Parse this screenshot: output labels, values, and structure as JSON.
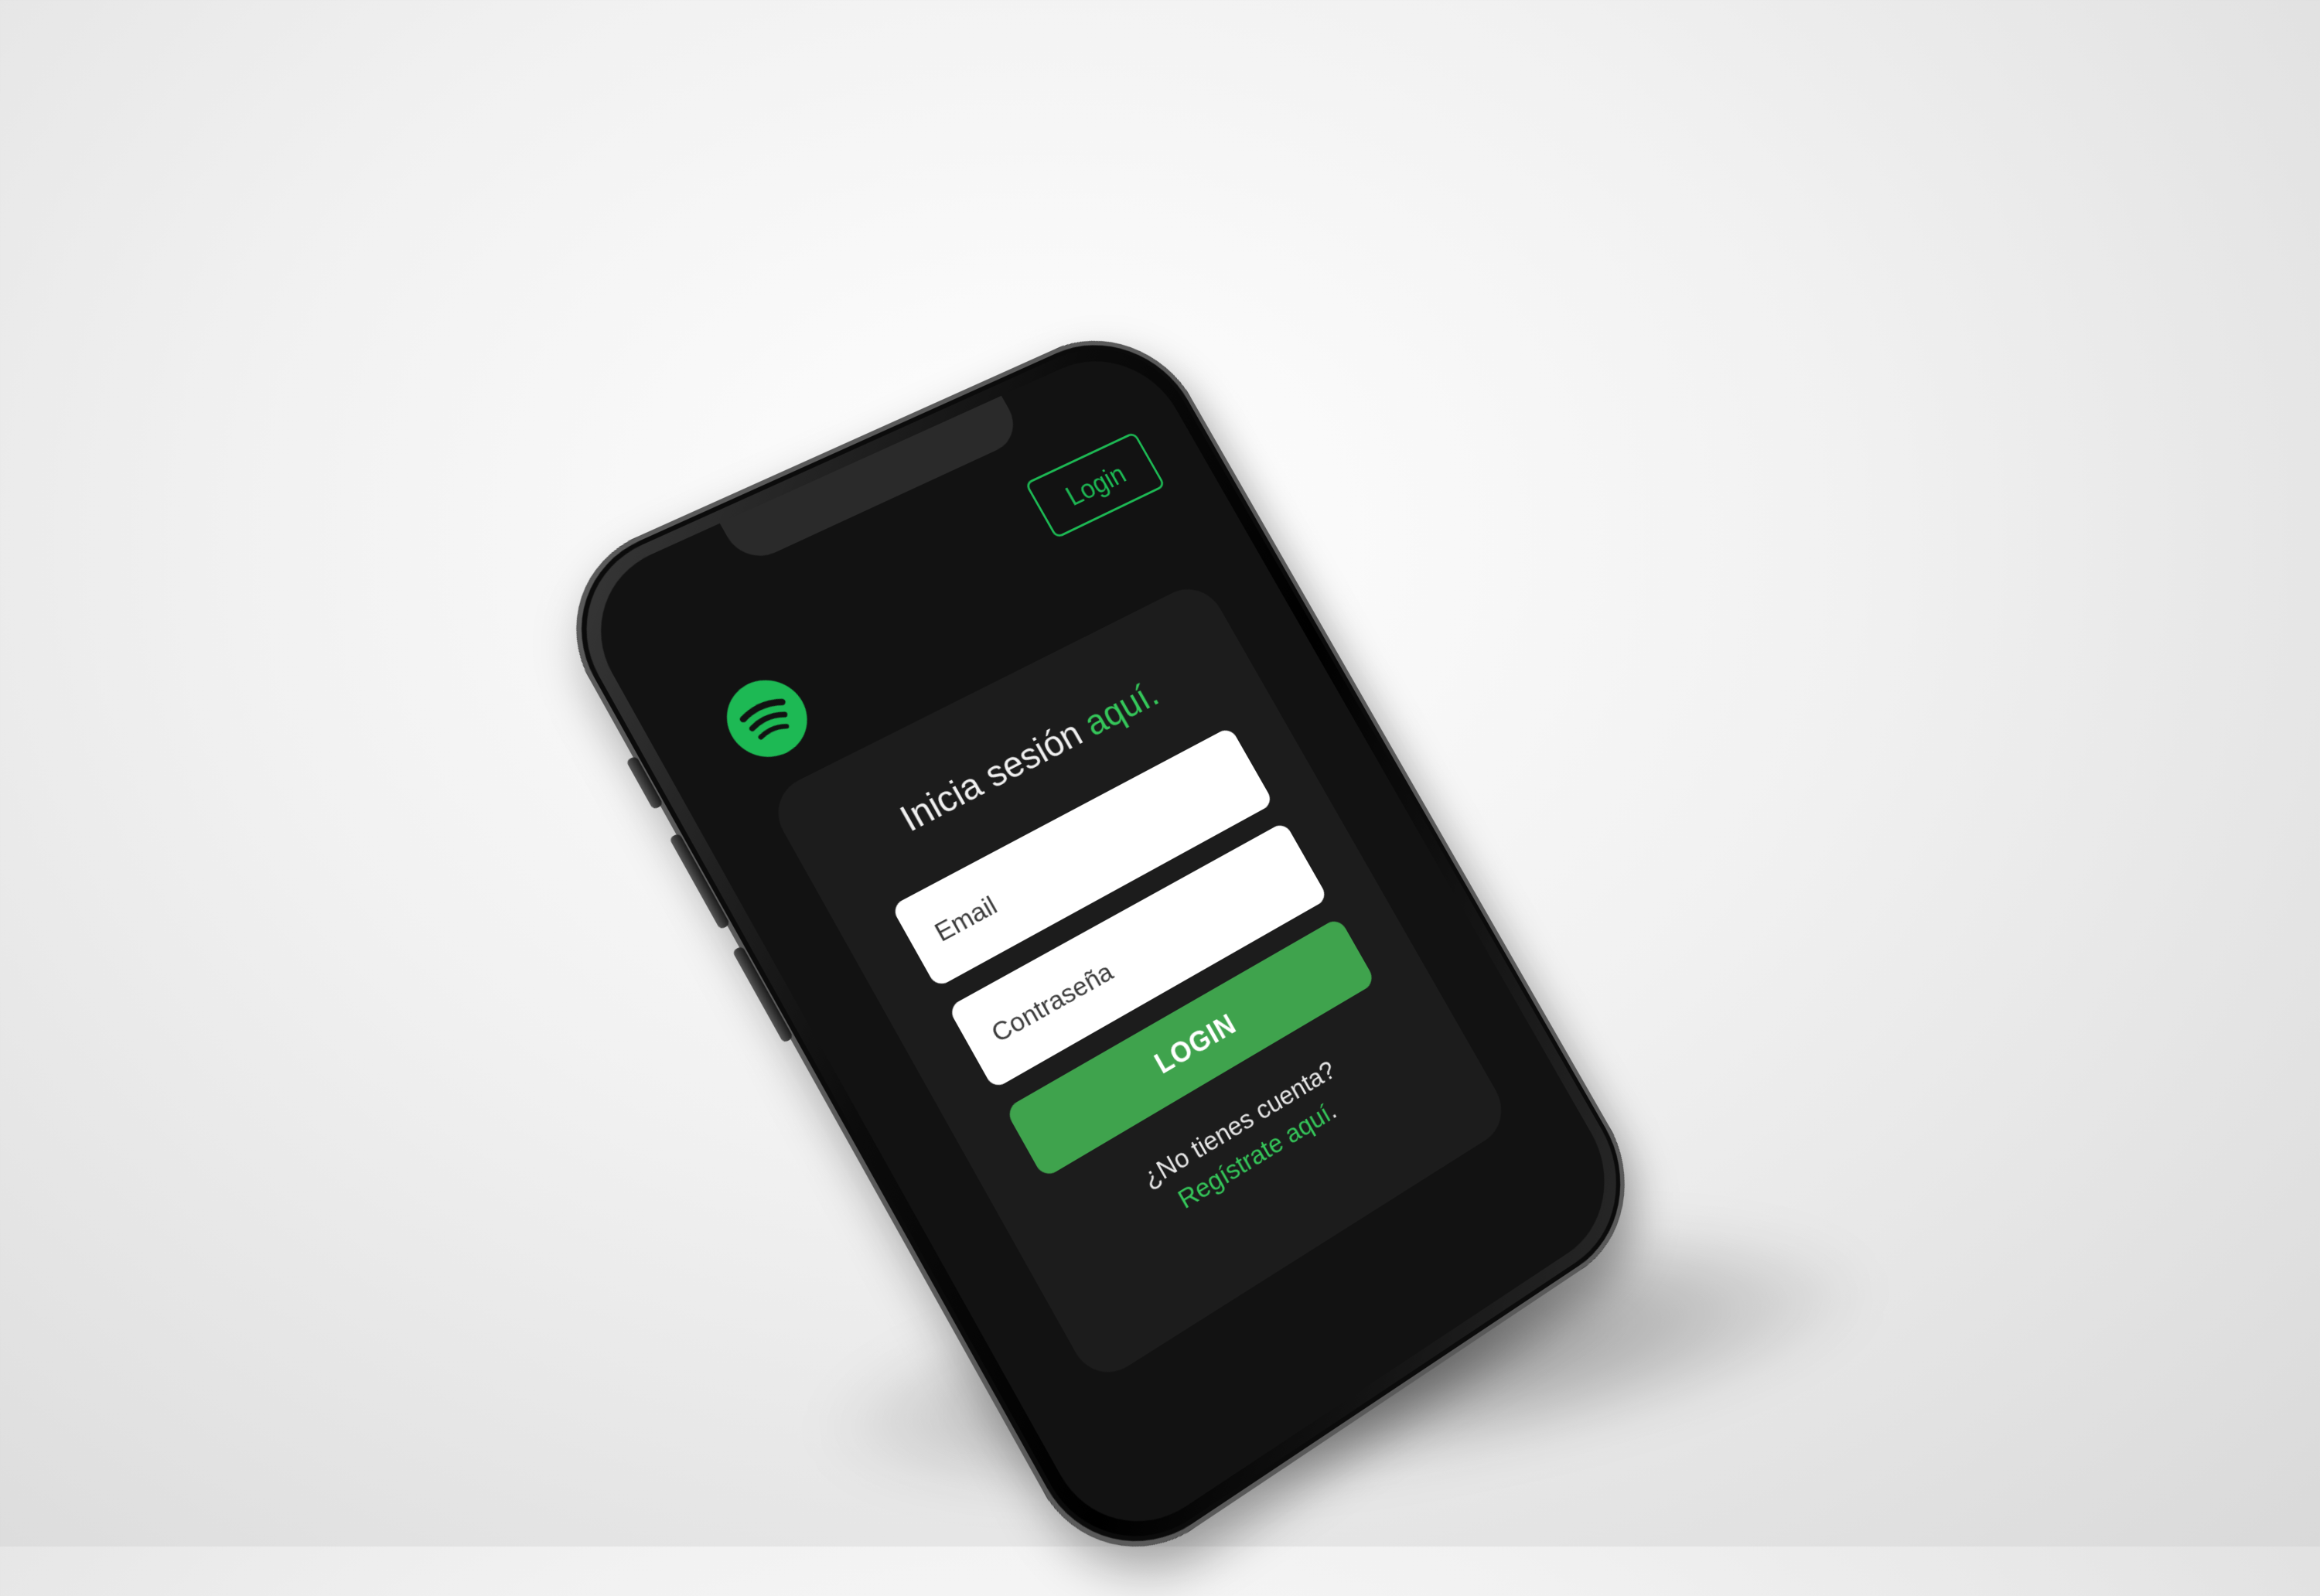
{
  "header": {
    "login_label": "Login",
    "logo_icon": "spotify-logo-icon"
  },
  "login_card": {
    "title_prefix": "Inicia sesión",
    "title_accent": "aquí.",
    "email": {
      "placeholder": "Email",
      "value": ""
    },
    "password": {
      "placeholder": "Contraseña",
      "value": ""
    },
    "submit_label": "LOGIN",
    "signup_prompt": "¿No tienes cuenta?",
    "signup_link": "Regístrate aquí",
    "signup_suffix": "."
  },
  "colors": {
    "brand_green": "#1db954",
    "button_green": "#3fa34d",
    "screen_background": "#121212",
    "card_background": "#1c1c1c"
  }
}
